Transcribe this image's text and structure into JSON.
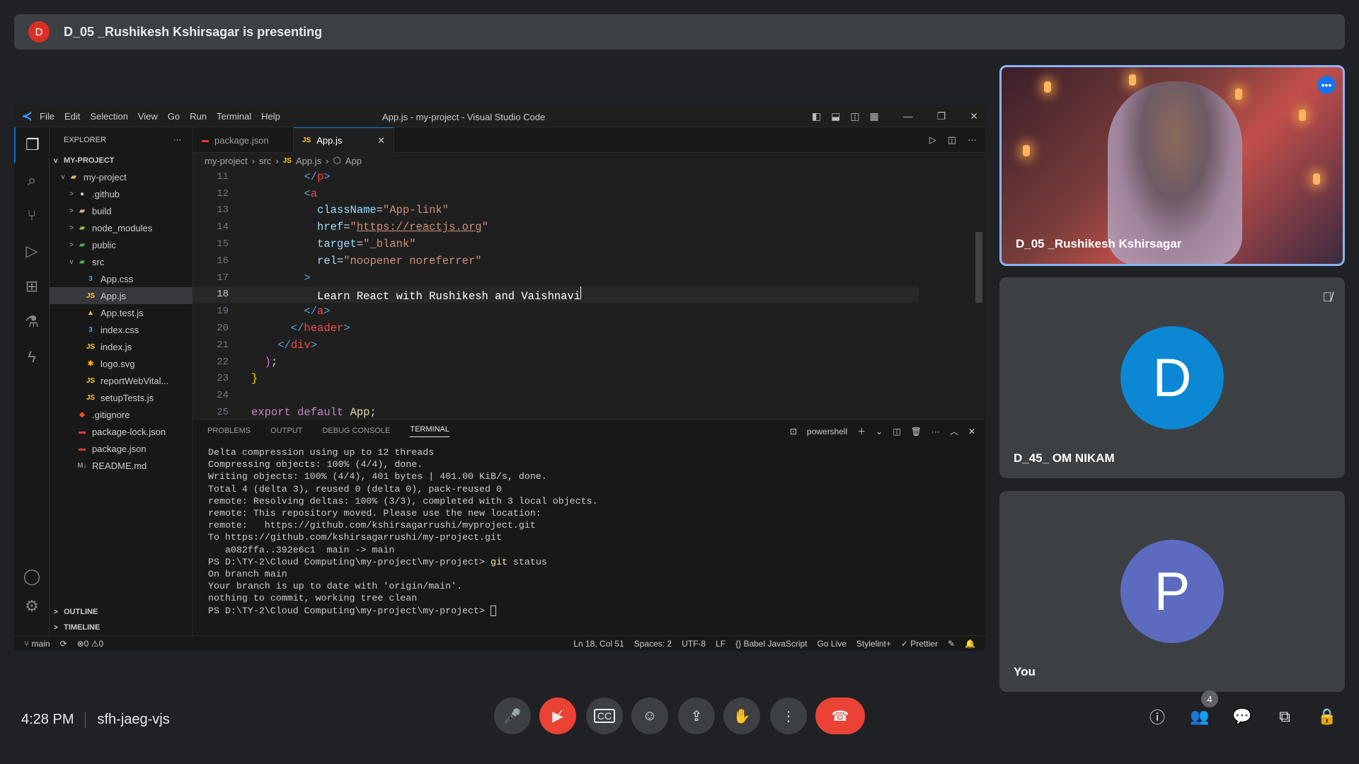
{
  "banner": {
    "avatar": "D",
    "text": "D_05 _Rushikesh Kshirsagar is presenting"
  },
  "vscode": {
    "menu": [
      "File",
      "Edit",
      "Selection",
      "View",
      "Go",
      "Run",
      "Terminal",
      "Help"
    ],
    "title": "App.js - my-project - Visual Studio Code",
    "explorer_title": "EXPLORER",
    "project_section": "MY-PROJECT",
    "tree": [
      {
        "label": "my-project",
        "indent": 1,
        "chev": "v",
        "icon": "folder-icon",
        "color": "#dcb67a",
        "g": "▰"
      },
      {
        "label": ".github",
        "indent": 2,
        "chev": ">",
        "icon": "github-folder-icon",
        "color": "#ccc",
        "g": "●"
      },
      {
        "label": "build",
        "indent": 2,
        "chev": ">",
        "icon": "folder-icon",
        "color": "#dcb67a",
        "g": "▰"
      },
      {
        "label": "node_modules",
        "indent": 2,
        "chev": ">",
        "icon": "node-folder-icon",
        "color": "#8bc34a",
        "g": "▰"
      },
      {
        "label": "public",
        "indent": 2,
        "chev": ">",
        "icon": "public-folder-icon",
        "color": "#4caf50",
        "g": "▰"
      },
      {
        "label": "src",
        "indent": 2,
        "chev": "v",
        "icon": "src-folder-icon",
        "color": "#4caf50",
        "g": "▰"
      },
      {
        "label": "App.css",
        "indent": 3,
        "chev": "",
        "icon": "css-icon",
        "color": "#42a5f5",
        "g": "3"
      },
      {
        "label": "App.js",
        "indent": 3,
        "chev": "",
        "icon": "js-icon",
        "color": "#ffca28",
        "g": "JS",
        "sel": true
      },
      {
        "label": "App.test.js",
        "indent": 3,
        "chev": "",
        "icon": "test-icon",
        "color": "#ffca28",
        "g": "▲"
      },
      {
        "label": "index.css",
        "indent": 3,
        "chev": "",
        "icon": "css-icon",
        "color": "#42a5f5",
        "g": "3"
      },
      {
        "label": "index.js",
        "indent": 3,
        "chev": "",
        "icon": "js-icon",
        "color": "#ffca28",
        "g": "JS"
      },
      {
        "label": "logo.svg",
        "indent": 3,
        "chev": "",
        "icon": "svg-icon",
        "color": "#ffb300",
        "g": "✱"
      },
      {
        "label": "reportWebVital...",
        "indent": 3,
        "chev": "",
        "icon": "js-icon",
        "color": "#ffca28",
        "g": "JS"
      },
      {
        "label": "setupTests.js",
        "indent": 3,
        "chev": "",
        "icon": "js-icon",
        "color": "#ffca28",
        "g": "JS"
      },
      {
        "label": ".gitignore",
        "indent": 2,
        "chev": "",
        "icon": "git-icon",
        "color": "#f4511e",
        "g": "◆"
      },
      {
        "label": "package-lock.json",
        "indent": 2,
        "chev": "",
        "icon": "npm-icon",
        "color": "#e53935",
        "g": "▬"
      },
      {
        "label": "package.json",
        "indent": 2,
        "chev": "",
        "icon": "npm-icon",
        "color": "#e53935",
        "g": "▬"
      },
      {
        "label": "README.md",
        "indent": 2,
        "chev": "",
        "icon": "markdown-icon",
        "color": "#888",
        "g": "M↓"
      }
    ],
    "outline": "OUTLINE",
    "timeline": "TIMELINE",
    "tabs": [
      {
        "label": "package.json",
        "icon": "▬",
        "icon_color": "#e53935"
      },
      {
        "label": "App.js",
        "icon": "JS",
        "icon_color": "#ffca28",
        "active": true
      }
    ],
    "breadcrumb": [
      "my-project",
      "src",
      "App.js",
      "App"
    ],
    "panel_tabs": [
      "PROBLEMS",
      "OUTPUT",
      "DEBUG CONSOLE",
      "TERMINAL"
    ],
    "shell": "powershell",
    "terminal_lines": [
      "Delta compression using up to 12 threads",
      "Compressing objects: 100% (4/4), done.",
      "Writing objects: 100% (4/4), 401 bytes | 401.00 KiB/s, done.",
      "Total 4 (delta 3), reused 0 (delta 0), pack-reused 0",
      "remote: Resolving deltas: 100% (3/3), completed with 3 local objects.",
      "remote: This repository moved. Please use the new location:",
      "remote:   https://github.com/kshirsagarrushi/myproject.git",
      "To https://github.com/kshirsagarrushi/my-project.git",
      "   a082ffa..392e6c1  main -> main",
      "PS D:\\TY-2\\Cloud Computing\\my-project\\my-project> ",
      "On branch main",
      "Your branch is up to date with 'origin/main'.",
      "",
      "nothing to commit, working tree clean",
      "PS D:\\TY-2\\Cloud Computing\\my-project\\my-project> "
    ],
    "git_cmd": "git",
    "git_arg": " status",
    "status_left": [
      "main",
      "⟳",
      "⊗0 ⚠0"
    ],
    "status_right": [
      "Ln 18, Col 51",
      "Spaces: 2",
      "UTF-8",
      "LF",
      "{} Babel JavaScript",
      "Go Live",
      "Stylelint+",
      "✓ Prettier"
    ]
  },
  "participants": [
    {
      "name": "D_05 _Rushikesh Kshirsagar"
    },
    {
      "name": "D_45_ OM NIKAM",
      "initial": "D",
      "color": "#0b87d4"
    },
    {
      "name": "You",
      "initial": "P",
      "color": "#5c6bc0"
    }
  ],
  "bottom": {
    "time": "4:28 PM",
    "code": "sfh-jaeg-vjs",
    "people_count": "4"
  }
}
